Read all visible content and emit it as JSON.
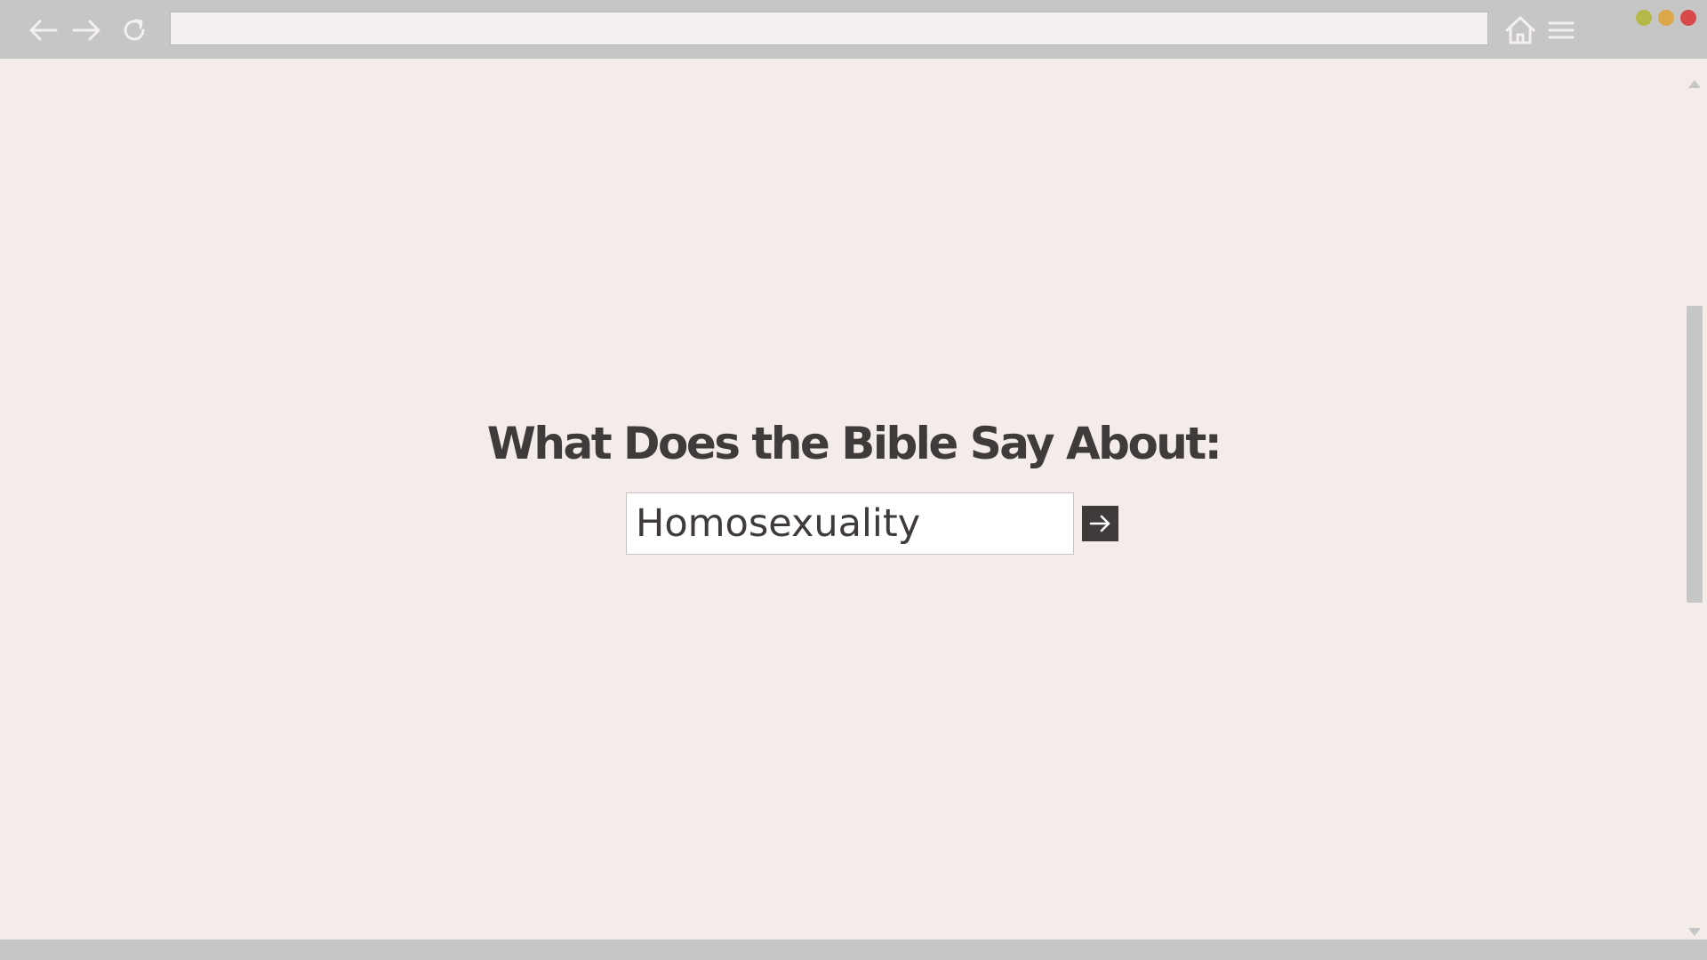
{
  "toolbar": {
    "address_value": "",
    "back_icon": "arrow-left-icon",
    "forward_icon": "arrow-right-icon",
    "reload_icon": "reload-icon",
    "home_icon": "home-icon",
    "menu_icon": "hamburger-menu-icon"
  },
  "window_controls": {
    "minimize_color": "#b5b84a",
    "maximize_color": "#dca84a",
    "close_color": "#d84a4a"
  },
  "main": {
    "headline": "What Does the Bible Say About:",
    "search_value": "Homosexuality",
    "go_icon": "arrow-right-icon"
  },
  "colors": {
    "page_background": "#f3ece9",
    "chrome": "#c6c6c6",
    "text_dark": "#3f3b3a"
  }
}
